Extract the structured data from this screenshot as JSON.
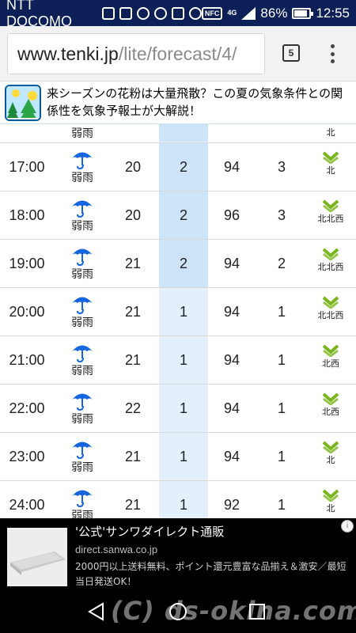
{
  "status_bar": {
    "carrier": "NTT DOCOMO",
    "nfc": "NFC",
    "network": "4G",
    "battery_percent": "86%",
    "battery_level": 0.86,
    "time": "12:55"
  },
  "browser": {
    "url_host": "www.tenki.jp",
    "url_path": "/lite/forecast/4/",
    "tab_count": "5"
  },
  "banner": {
    "text": "来シーズンの花粉は大量飛散？この夏の気象条件との関係性を気象予報士が大解説！"
  },
  "forecast": {
    "top_partial": {
      "weather": "弱雨",
      "wind_dir": "北"
    },
    "rows": [
      {
        "time": "17:00",
        "weather": "弱雨",
        "temp": "20",
        "precip_prob": "2",
        "humidity": "94",
        "rain": "3",
        "wind_dir": "北",
        "highlight": true
      },
      {
        "time": "18:00",
        "weather": "弱雨",
        "temp": "20",
        "precip_prob": "2",
        "humidity": "96",
        "rain": "3",
        "wind_dir": "北北西",
        "highlight": true
      },
      {
        "time": "19:00",
        "weather": "弱雨",
        "temp": "21",
        "precip_prob": "2",
        "humidity": "94",
        "rain": "2",
        "wind_dir": "北北西",
        "highlight": true
      },
      {
        "time": "20:00",
        "weather": "弱雨",
        "temp": "21",
        "precip_prob": "1",
        "humidity": "94",
        "rain": "1",
        "wind_dir": "北北西",
        "highlight": false
      },
      {
        "time": "21:00",
        "weather": "弱雨",
        "temp": "21",
        "precip_prob": "1",
        "humidity": "94",
        "rain": "1",
        "wind_dir": "北西",
        "highlight": false
      },
      {
        "time": "22:00",
        "weather": "弱雨",
        "temp": "22",
        "precip_prob": "1",
        "humidity": "94",
        "rain": "1",
        "wind_dir": "北西",
        "highlight": false
      },
      {
        "time": "23:00",
        "weather": "弱雨",
        "temp": "21",
        "precip_prob": "1",
        "humidity": "94",
        "rain": "1",
        "wind_dir": "北",
        "highlight": false
      },
      {
        "time": "24:00",
        "weather": "弱雨",
        "temp": "21",
        "precip_prob": "1",
        "humidity": "92",
        "rain": "1",
        "wind_dir": "北",
        "highlight": false
      }
    ]
  },
  "ad": {
    "title": "'公式'サンワダイレクト通販",
    "domain": "direct.sanwa.co.jp",
    "body": "2000円以上送料無料、ポイント還元豊富な品揃え＆激安／最短当日発送OK！",
    "info_icon": "info-icon"
  },
  "watermark": "(C) ds-okina.com",
  "colors": {
    "status_bar": "#0c1f56",
    "umbrella": "#1565e0",
    "wind_arrow": "#7ab51d",
    "highlight_strong": "#cde3f7",
    "highlight_light": "#e3f0fc"
  }
}
